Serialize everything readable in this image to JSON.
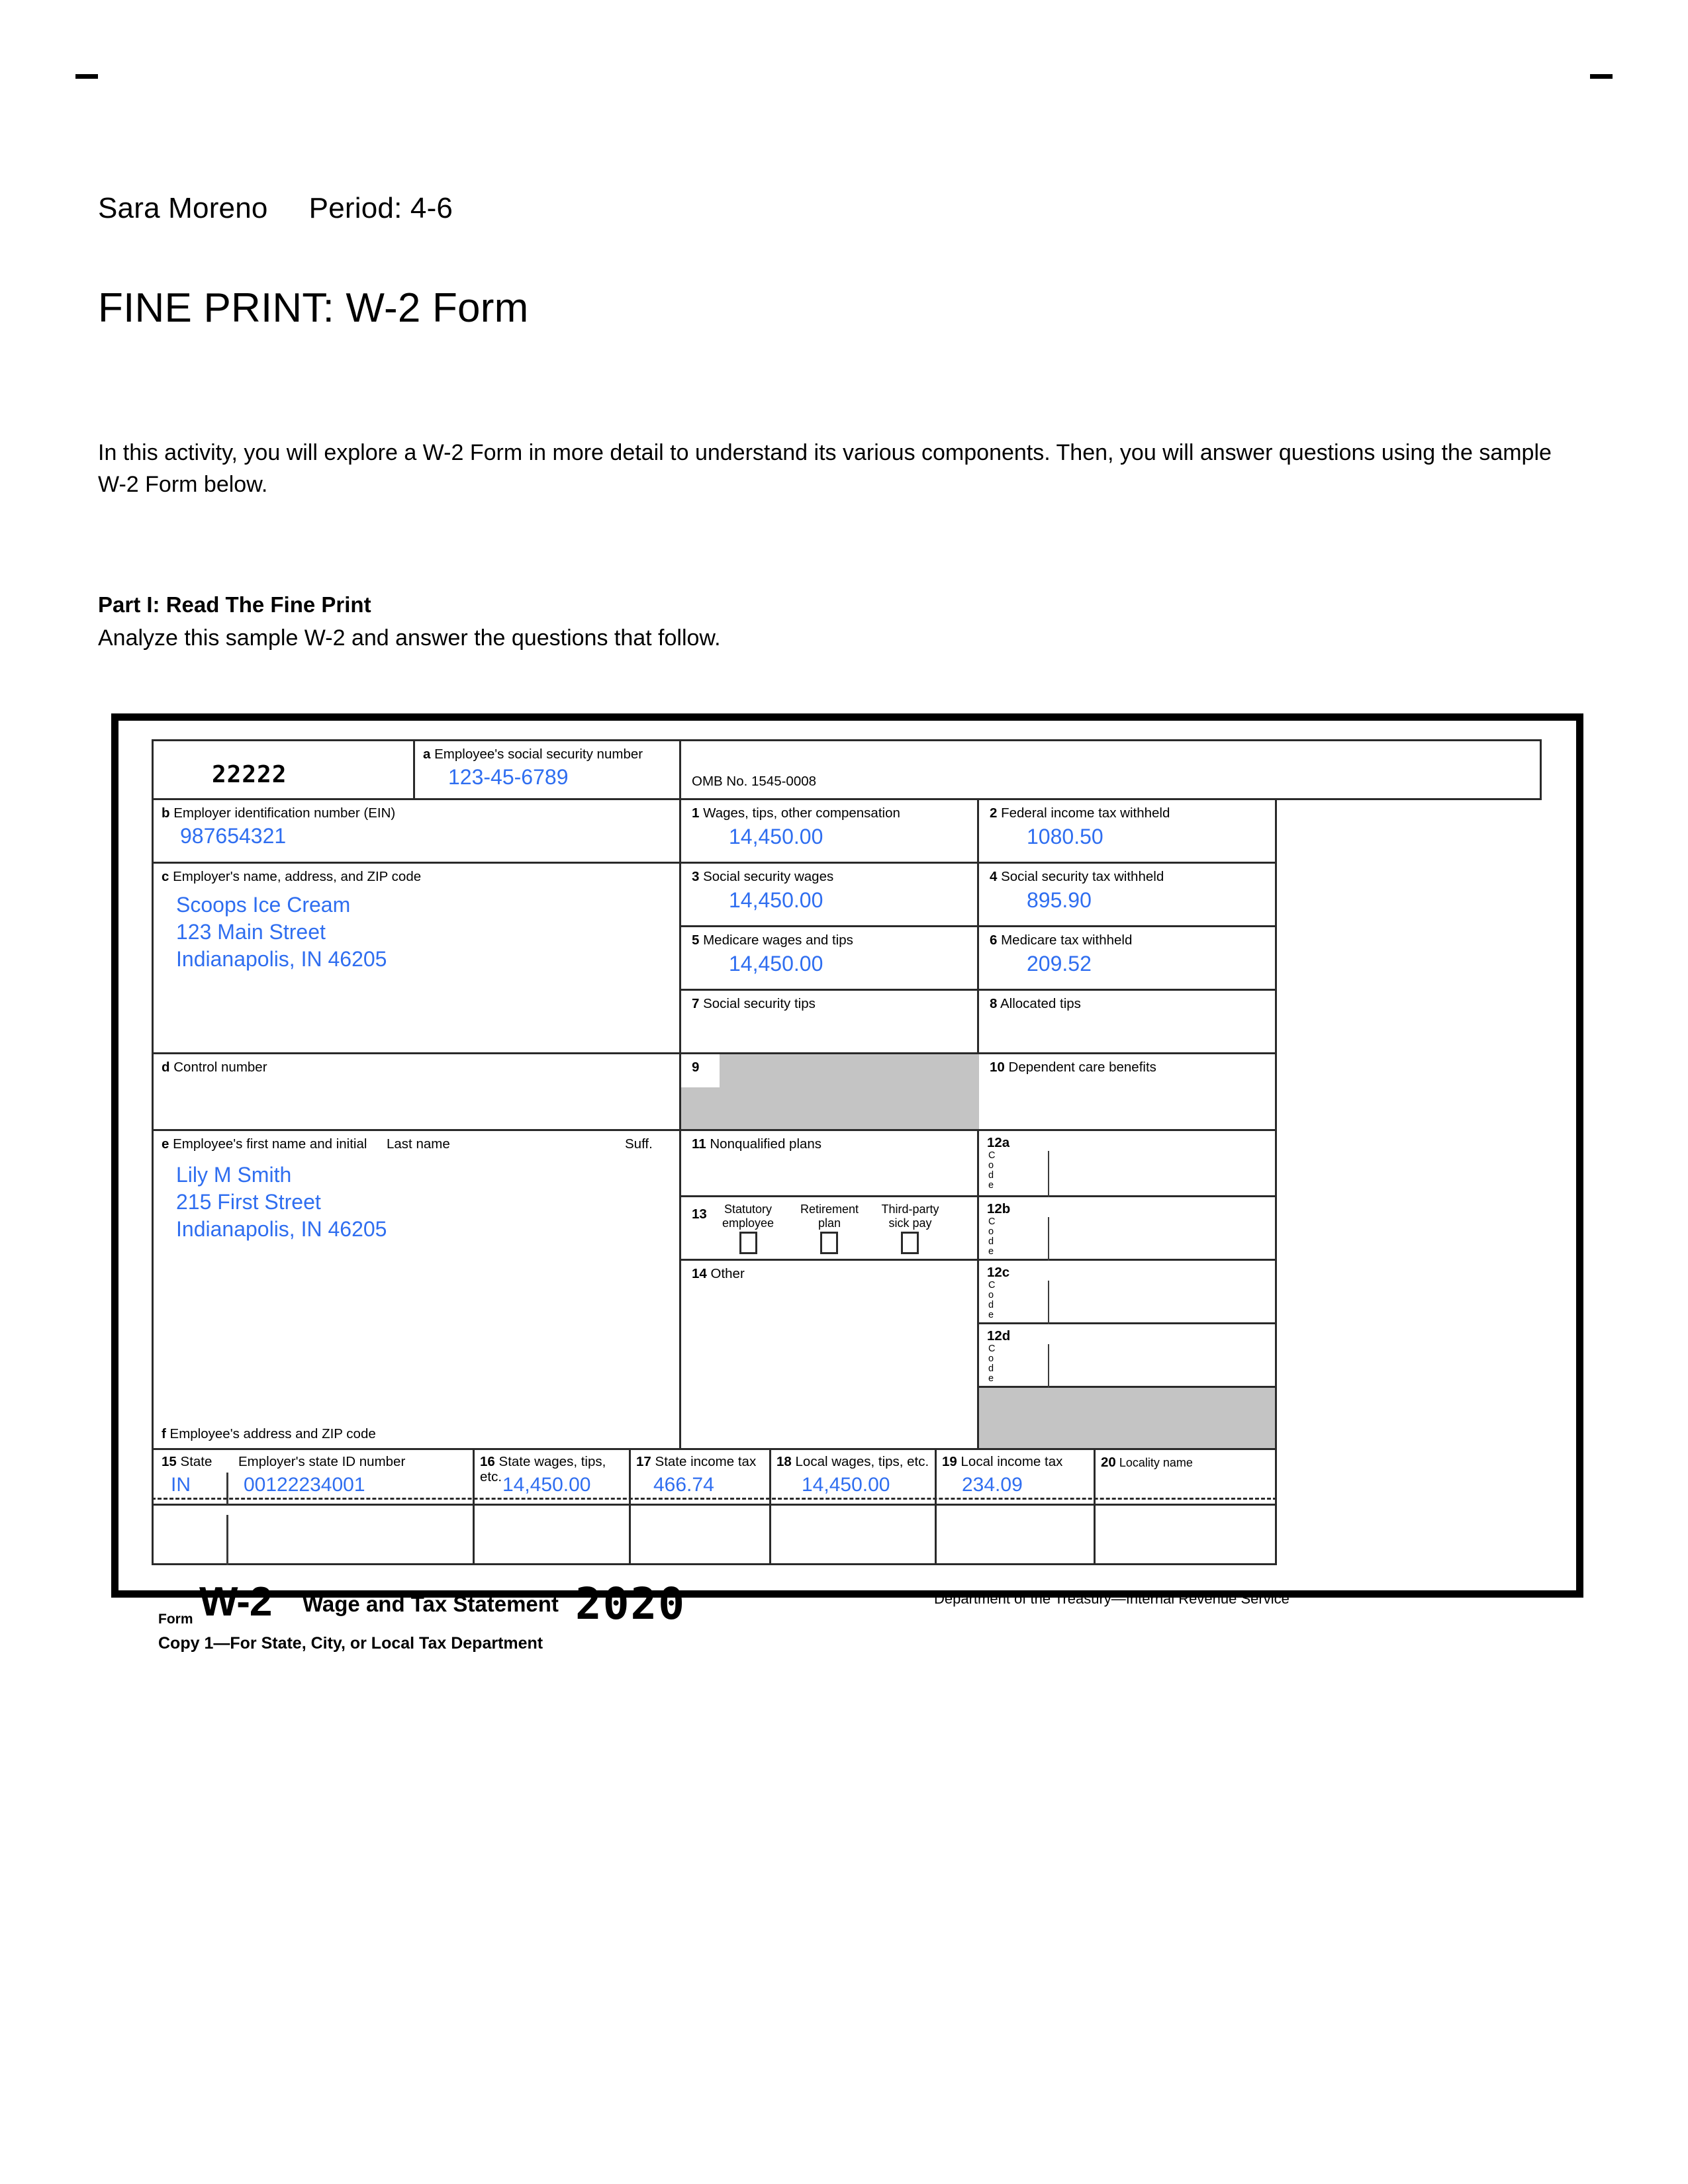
{
  "document": {
    "student_line": "Sara Moreno     Period: 4-6",
    "title": "FINE PRINT: W-2 Form",
    "intro": "In this activity, you will explore a W-2 Form in more detail to understand its various components. Then, you will answer questions using the sample W-2 Form below.",
    "part_heading": "Part I: Read The Fine Print",
    "part_subtext": "Analyze this sample W-2 and answer the questions that follow."
  },
  "colors": {
    "filled_value_blue": "#2f6ef0",
    "shaded_gray": "#c4c4c4",
    "rule_black": "#2a2a2a"
  },
  "w2": {
    "void_code": "22222",
    "box_a": {
      "label": "Employee's social security number",
      "letter": "a",
      "value": "123-45-6789"
    },
    "omb": "OMB No. 1545-0008",
    "box_b": {
      "letter": "b",
      "label": "Employer identification number (EIN)",
      "value": "987654321"
    },
    "box_c": {
      "letter": "c",
      "label": "Employer's name, address, and ZIP code",
      "lines": [
        "Scoops Ice Cream",
        "123 Main Street",
        "Indianapolis, IN 46205"
      ]
    },
    "box_d": {
      "letter": "d",
      "label": "Control number",
      "value": ""
    },
    "box_e": {
      "letter": "e",
      "label_first": "Employee's first name and initial",
      "label_last": "Last name",
      "label_suffix": "Suff.",
      "lines": [
        "Lily M Smith",
        "215 First Street",
        "Indianapolis, IN 46205"
      ]
    },
    "box_f": {
      "letter": "f",
      "label": "Employee's address and ZIP code"
    },
    "box_1": {
      "num": "1",
      "label": "Wages, tips, other compensation",
      "value": "14,450.00"
    },
    "box_2": {
      "num": "2",
      "label": "Federal income tax withheld",
      "value": "1080.50"
    },
    "box_3": {
      "num": "3",
      "label": "Social security wages",
      "value": "14,450.00"
    },
    "box_4": {
      "num": "4",
      "label": "Social security tax withheld",
      "value": "895.90"
    },
    "box_5": {
      "num": "5",
      "label": "Medicare wages and tips",
      "value": "14,450.00"
    },
    "box_6": {
      "num": "6",
      "label": "Medicare tax withheld",
      "value": "209.52"
    },
    "box_7": {
      "num": "7",
      "label": "Social security tips",
      "value": ""
    },
    "box_8": {
      "num": "8",
      "label": "Allocated tips",
      "value": ""
    },
    "box_9": {
      "num": "9",
      "label": "",
      "value": "",
      "shaded": true
    },
    "box_10": {
      "num": "10",
      "label": "Dependent care benefits",
      "value": ""
    },
    "box_11": {
      "num": "11",
      "label": "Nonqualified plans",
      "value": ""
    },
    "box_12": {
      "code_label": "Code",
      "rows": [
        {
          "num": "12a",
          "code": "",
          "value": ""
        },
        {
          "num": "12b",
          "code": "",
          "value": ""
        },
        {
          "num": "12c",
          "code": "",
          "value": ""
        },
        {
          "num": "12d",
          "code": "",
          "value": ""
        }
      ]
    },
    "box_13": {
      "num": "13",
      "checkboxes": [
        {
          "label_line1": "Statutory",
          "label_line2": "employee",
          "checked": false
        },
        {
          "label_line1": "Retirement",
          "label_line2": "plan",
          "checked": false
        },
        {
          "label_line1": "Third-party",
          "label_line2": "sick pay",
          "checked": false
        }
      ]
    },
    "box_14": {
      "num": "14",
      "label": "Other",
      "value": ""
    },
    "box_15": {
      "num": "15",
      "label_state": "State",
      "label_id": "Employer's state ID number",
      "state": "IN",
      "id_value": "00122234001"
    },
    "box_16": {
      "num": "16",
      "label": "State wages, tips, etc.",
      "value": "14,450.00"
    },
    "box_17": {
      "num": "17",
      "label": "State income tax",
      "value": "466.74"
    },
    "box_18": {
      "num": "18",
      "label": "Local wages, tips, etc.",
      "value": "14,450.00"
    },
    "box_19": {
      "num": "19",
      "label": "Local income tax",
      "value": "234.09"
    },
    "box_20": {
      "num": "20",
      "label": "Locality name",
      "value": ""
    },
    "footer": {
      "form_word": "Form",
      "form_number": "W-2",
      "statement": "Wage and Tax Statement",
      "copy_line": "Copy 1—For State, City, or Local Tax Department",
      "year": "2020",
      "department": "Department of the Treasury—Internal Revenue Service"
    }
  }
}
